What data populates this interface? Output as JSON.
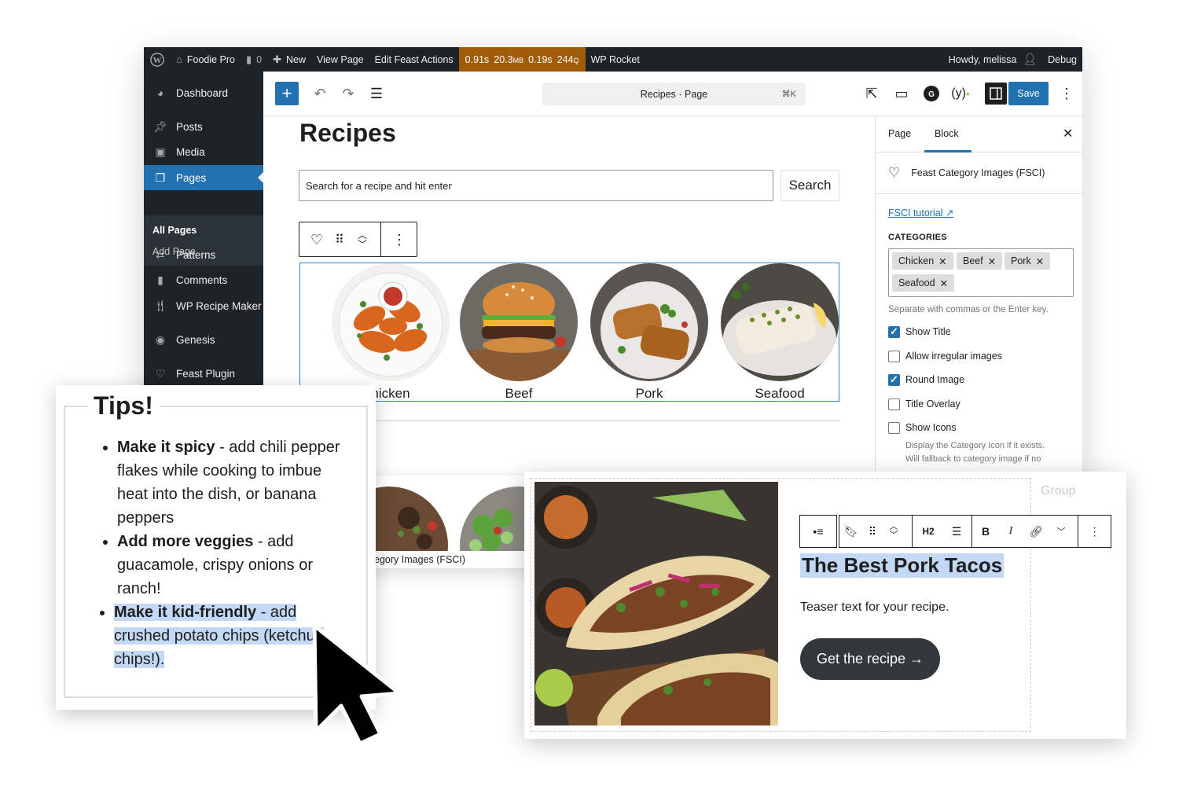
{
  "adminbar": {
    "site_name": "Foodie Pro",
    "comments_count": "0",
    "new_label": "New",
    "view_page": "View Page",
    "edit_feast": "Edit Feast Actions",
    "perf": {
      "t1": "0.91s",
      "mem": "20.3",
      "mem_unit": "MB",
      "t2": "0.19s",
      "queries": "244",
      "q_unit": "Q"
    },
    "wp_rocket": "WP Rocket",
    "howdy": "Howdy, melissa",
    "debug": "Debug"
  },
  "sidebar": {
    "items": [
      {
        "label": "Dashboard"
      },
      {
        "label": "Posts"
      },
      {
        "label": "Media"
      },
      {
        "label": "Pages"
      },
      {
        "label": "Patterns"
      },
      {
        "label": "Comments"
      },
      {
        "label": "WP Recipe Maker"
      },
      {
        "label": "Genesis"
      },
      {
        "label": "Feast Plugin"
      }
    ],
    "submenu": {
      "all_pages": "All Pages",
      "add_page": "Add Page"
    }
  },
  "editor": {
    "command_bar": "Recipes · Page",
    "shortcut": "⌘K",
    "save_label": "Save"
  },
  "canvas": {
    "page_title": "Recipes",
    "search_placeholder": "Search for a recipe and hit enter",
    "search_button": "Search",
    "categories": [
      {
        "label": "hicken"
      },
      {
        "label": "Beef"
      },
      {
        "label": "Pork"
      },
      {
        "label": "Seafood"
      }
    ],
    "block_caption": "egory Images (FSCI)"
  },
  "settings": {
    "tab_page": "Page",
    "tab_block": "Block",
    "block_name": "Feast Category Images (FSCI)",
    "tutorial_link": "FSCI tutorial ↗",
    "categories_heading": "CATEGORIES",
    "tokens": [
      "Chicken",
      "Beef",
      "Pork",
      "Seafood"
    ],
    "token_help": "Separate with commas or the Enter key.",
    "options": [
      {
        "label": "Show Title",
        "checked": true
      },
      {
        "label": "Allow irregular images",
        "checked": false
      },
      {
        "label": "Round Image",
        "checked": true
      },
      {
        "label": "Title Overlay",
        "checked": false
      },
      {
        "label": "Show Icons",
        "checked": false
      }
    ],
    "icon_help_1": "Display the Category Icon if it exists.",
    "icon_help_2": "Will fallback to category image if no"
  },
  "tips": {
    "title": "Tips!",
    "items": [
      {
        "bold": "Make it spicy",
        "text": " - add chili pepper flakes while cooking to imbue heat into the dish, or banana peppers"
      },
      {
        "bold": "Add more veggies",
        "text": " - add guacamole, crispy onions or ranch!"
      },
      {
        "bold": "Make it kid-friendly",
        "text": " - add crushed potato chips (ketchup chips!)."
      }
    ]
  },
  "card": {
    "group_label": "Group",
    "heading_level": "H2",
    "heading": "The Best Pork Tacos",
    "teaser": "Teaser text for your recipe.",
    "button": "Get the recipe →"
  },
  "colors": {
    "admin_bg": "#1d2327",
    "accent": "#2271b1",
    "perf_bg": "#a15c07",
    "highlight": "#c3d8f5"
  }
}
